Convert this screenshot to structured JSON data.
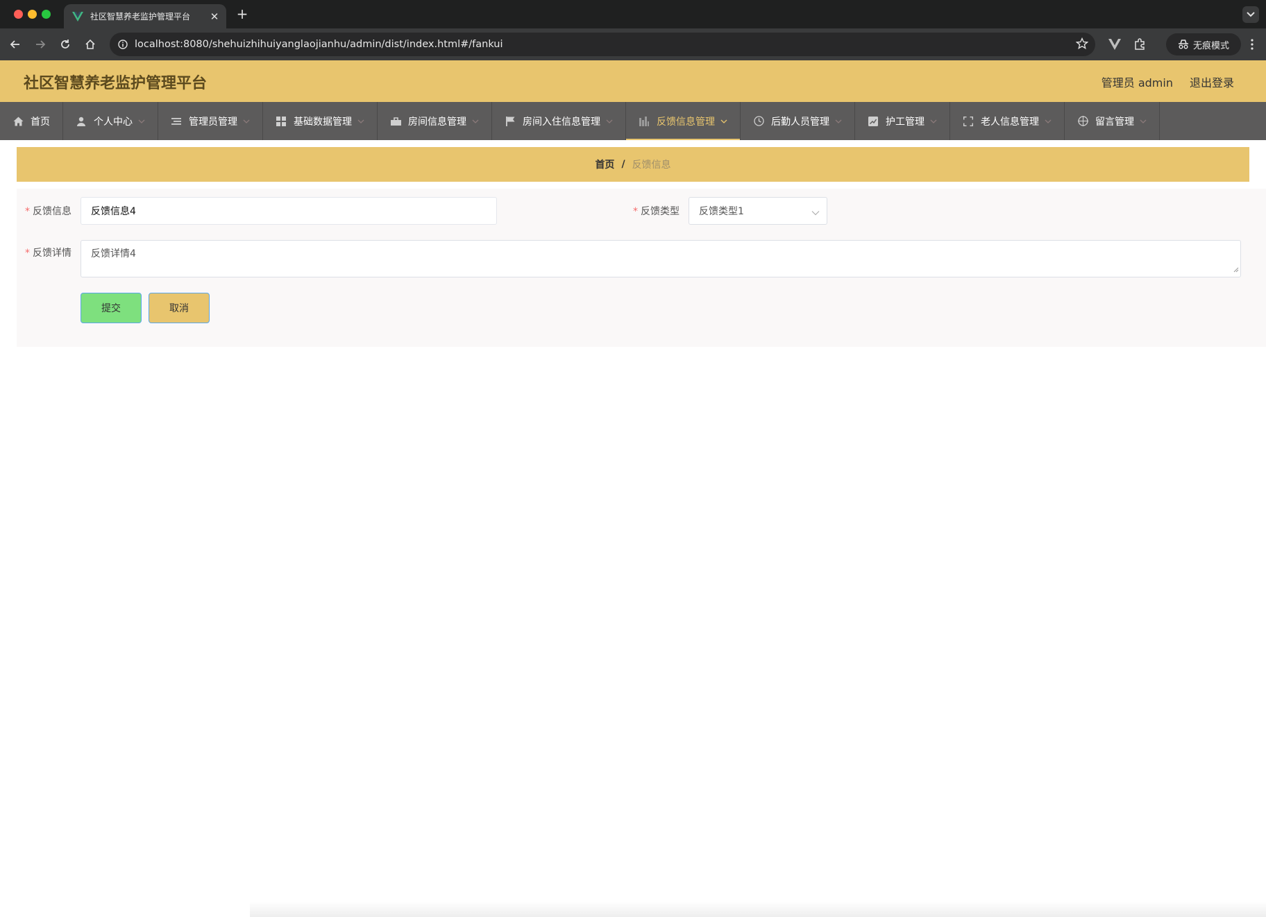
{
  "browser": {
    "tab_title": "社区智慧养老监护管理平台",
    "url": "localhost:8080/shehuizhihuiyanglaojianhu/admin/dist/index.html#/fankui",
    "incognito_label": "无痕模式"
  },
  "header": {
    "title": "社区智慧养老监护管理平台",
    "user_label": "管理员 admin",
    "logout_label": "退出登录"
  },
  "nav": {
    "items": [
      {
        "label": "首页",
        "icon": "home-icon"
      },
      {
        "label": "个人中心",
        "icon": "user-icon"
      },
      {
        "label": "管理员管理",
        "icon": "list-icon"
      },
      {
        "label": "基础数据管理",
        "icon": "grid-icon"
      },
      {
        "label": "房间信息管理",
        "icon": "bag-icon"
      },
      {
        "label": "房间入住信息管理",
        "icon": "flag-icon"
      },
      {
        "label": "反馈信息管理",
        "icon": "chart-icon"
      },
      {
        "label": "后勤人员管理",
        "icon": "clock-icon"
      },
      {
        "label": "护工管理",
        "icon": "trend-icon"
      },
      {
        "label": "老人信息管理",
        "icon": "fullscreen-icon"
      },
      {
        "label": "留言管理",
        "icon": "target-icon"
      }
    ]
  },
  "breadcrumb": {
    "home": "首页",
    "separator": "/",
    "current": "反馈信息"
  },
  "form": {
    "feedback_info_label": "反馈信息",
    "feedback_info_value": "反馈信息4",
    "feedback_type_label": "反馈类型",
    "feedback_type_value": "反馈类型1",
    "feedback_detail_label": "反馈详情",
    "feedback_detail_value": "反馈详情4",
    "required_mark": "*",
    "submit_label": "提交",
    "cancel_label": "取消"
  },
  "colors": {
    "accent": "#e8c56e",
    "nav_bg": "#5c5b5b",
    "submit_bg": "#7ee07e",
    "required": "#f56c6c"
  }
}
